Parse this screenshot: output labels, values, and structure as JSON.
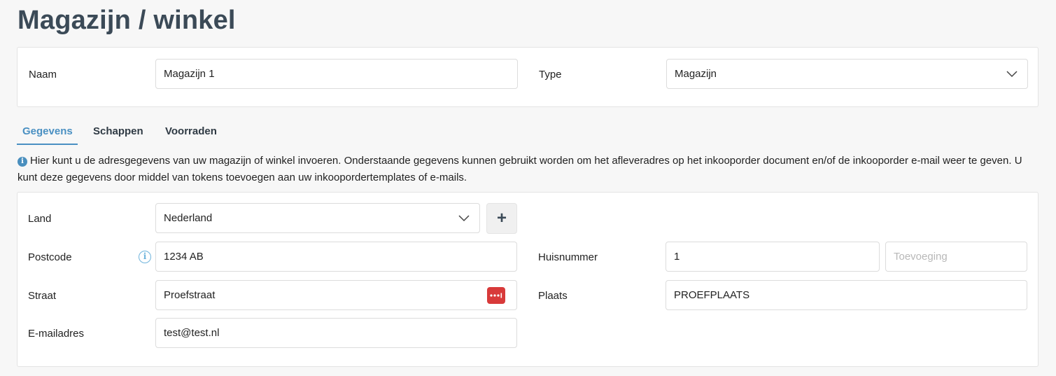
{
  "page": {
    "title": "Magazijn / winkel"
  },
  "header_form": {
    "name_label": "Naam",
    "name_value": "Magazijn 1",
    "type_label": "Type",
    "type_value": "Magazijn"
  },
  "tabs": [
    {
      "label": "Gegevens",
      "active": true
    },
    {
      "label": "Schappen",
      "active": false
    },
    {
      "label": "Voorraden",
      "active": false
    }
  ],
  "info": {
    "text": "Hier kunt u de adresgegevens van uw magazijn of winkel invoeren. Onderstaande gegevens kunnen gebruikt worden om het afleveradres op het inkooporder document en/of de inkooporder e-mail weer te geven. U kunt deze gegevens door middel van tokens toevoegen aan uw inkoopordertemplates of e-mails."
  },
  "address_form": {
    "country_label": "Land",
    "country_value": "Nederland",
    "add_button": "+",
    "postcode_label": "Postcode",
    "postcode_value": "1234 AB",
    "housenumber_label": "Huisnummer",
    "housenumber_value": "1",
    "addition_placeholder": "Toevoeging",
    "street_label": "Straat",
    "street_value": "Proefstraat",
    "city_label": "Plaats",
    "city_value": "PROEFPLAATS",
    "email_label": "E-mailadres",
    "email_value": "test@test.nl"
  },
  "colors": {
    "accent": "#4a90c2",
    "title": "#3b4a57",
    "password_icon": "#d83a3a"
  }
}
